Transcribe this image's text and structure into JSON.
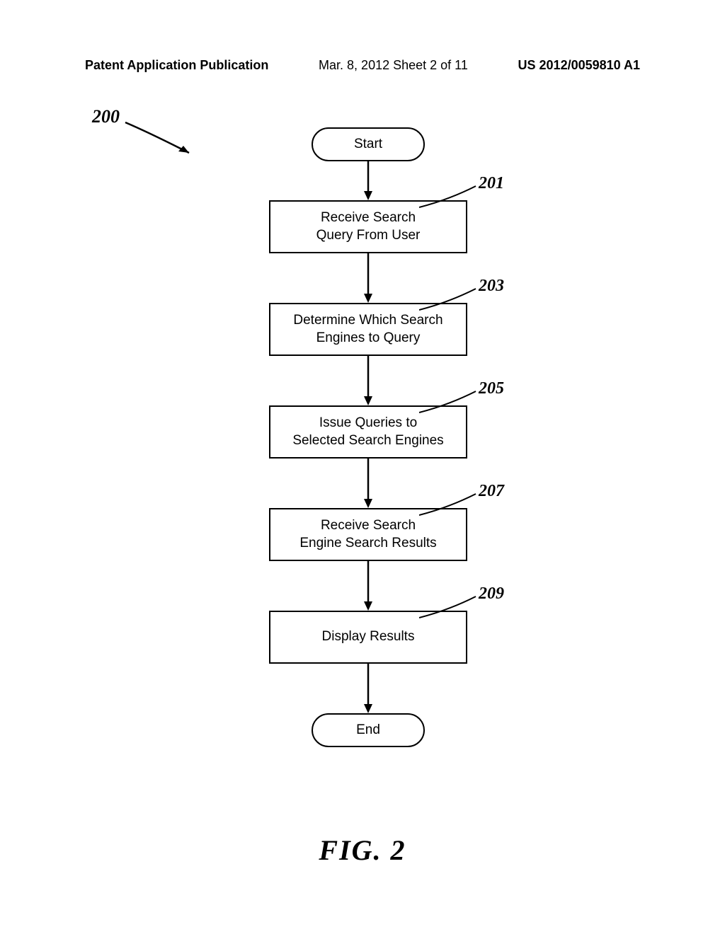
{
  "header": {
    "left": "Patent Application Publication",
    "center": "Mar. 8, 2012  Sheet 2 of 11",
    "right": "US 2012/0059810 A1"
  },
  "figure_ref": "200",
  "flowchart": {
    "start": "Start",
    "end": "End",
    "steps": [
      {
        "label": "201",
        "text": "Receive Search\nQuery From User"
      },
      {
        "label": "203",
        "text": "Determine Which Search\nEngines to Query"
      },
      {
        "label": "205",
        "text": "Issue Queries to\nSelected Search Engines"
      },
      {
        "label": "207",
        "text": "Receive Search\nEngine Search Results"
      },
      {
        "label": "209",
        "text": "Display Results"
      }
    ]
  },
  "caption": "FIG.  2"
}
